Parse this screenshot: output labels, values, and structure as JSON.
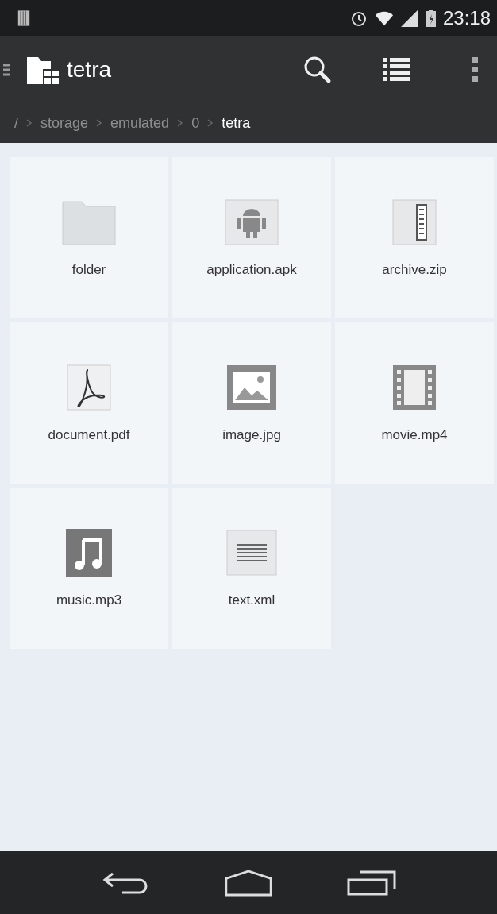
{
  "status_bar": {
    "time": "23:18"
  },
  "action_bar": {
    "title": "tetra"
  },
  "breadcrumb": [
    {
      "label": "/",
      "selected": false
    },
    {
      "label": "storage",
      "selected": false
    },
    {
      "label": "emulated",
      "selected": false
    },
    {
      "label": "0",
      "selected": false
    },
    {
      "label": "tetra",
      "selected": true
    }
  ],
  "files": [
    {
      "name": "folder",
      "kind": "folder"
    },
    {
      "name": "application.apk",
      "kind": "apk"
    },
    {
      "name": "archive.zip",
      "kind": "zip"
    },
    {
      "name": "document.pdf",
      "kind": "pdf"
    },
    {
      "name": "image.jpg",
      "kind": "image"
    },
    {
      "name": "movie.mp4",
      "kind": "video"
    },
    {
      "name": "music.mp3",
      "kind": "audio"
    },
    {
      "name": "text.xml",
      "kind": "text"
    }
  ]
}
